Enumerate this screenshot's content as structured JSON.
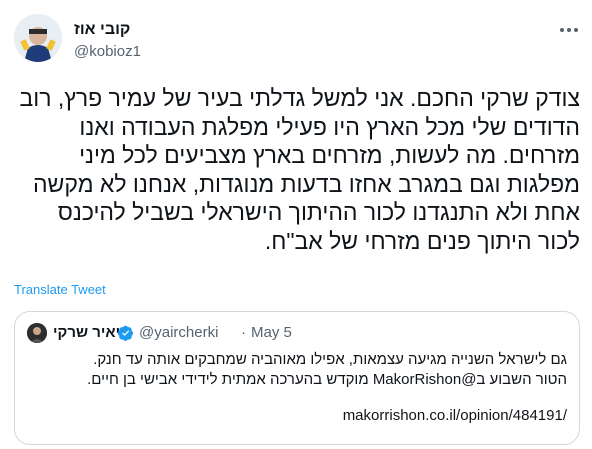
{
  "author": {
    "display_name": "קובי אוז",
    "handle": "@kobioz1"
  },
  "tweet": {
    "text": "צודק שרקי החכם. אני למשל גדלתי בעיר של עמיר פרץ, רוב הדודים שלי מכל הארץ היו פעילי מפלגת העבודה ואנו מזרחים. מה לעשות, מזרחים בארץ מצביעים לכל מיני מפלגות וגם במגרב אחזו בדעות מנוגדות, אנחנו לא מקשה אחת ולא התנגדנו לכור ההיתוך הישראלי בשביל להיכנס לכור היתוך פנים מזרחי של אב\"ח.",
    "translate_label": "Translate Tweet"
  },
  "quoted_tweet": {
    "display_name": "יאיר שרקי",
    "handle": "@yaircherki",
    "separator": "·",
    "date": "May 5",
    "text_line1": "גם לישראל השנייה מגיעה עצמאות, אפילו מאוהביה שמחבקים אותה עד חנק.",
    "text_line2": "הטור השבוע ב@MakorRishon מוקדש בהערכה אמתית לידידי אבישי בן חיים.",
    "link": "makorrishon.co.il/opinion/484191/"
  },
  "icons": {
    "more": "more-dots-icon",
    "verified": "verified-badge-icon"
  },
  "colors": {
    "link_blue": "#1d9bf0",
    "secondary_text": "#536471",
    "border": "#cfd9de"
  }
}
